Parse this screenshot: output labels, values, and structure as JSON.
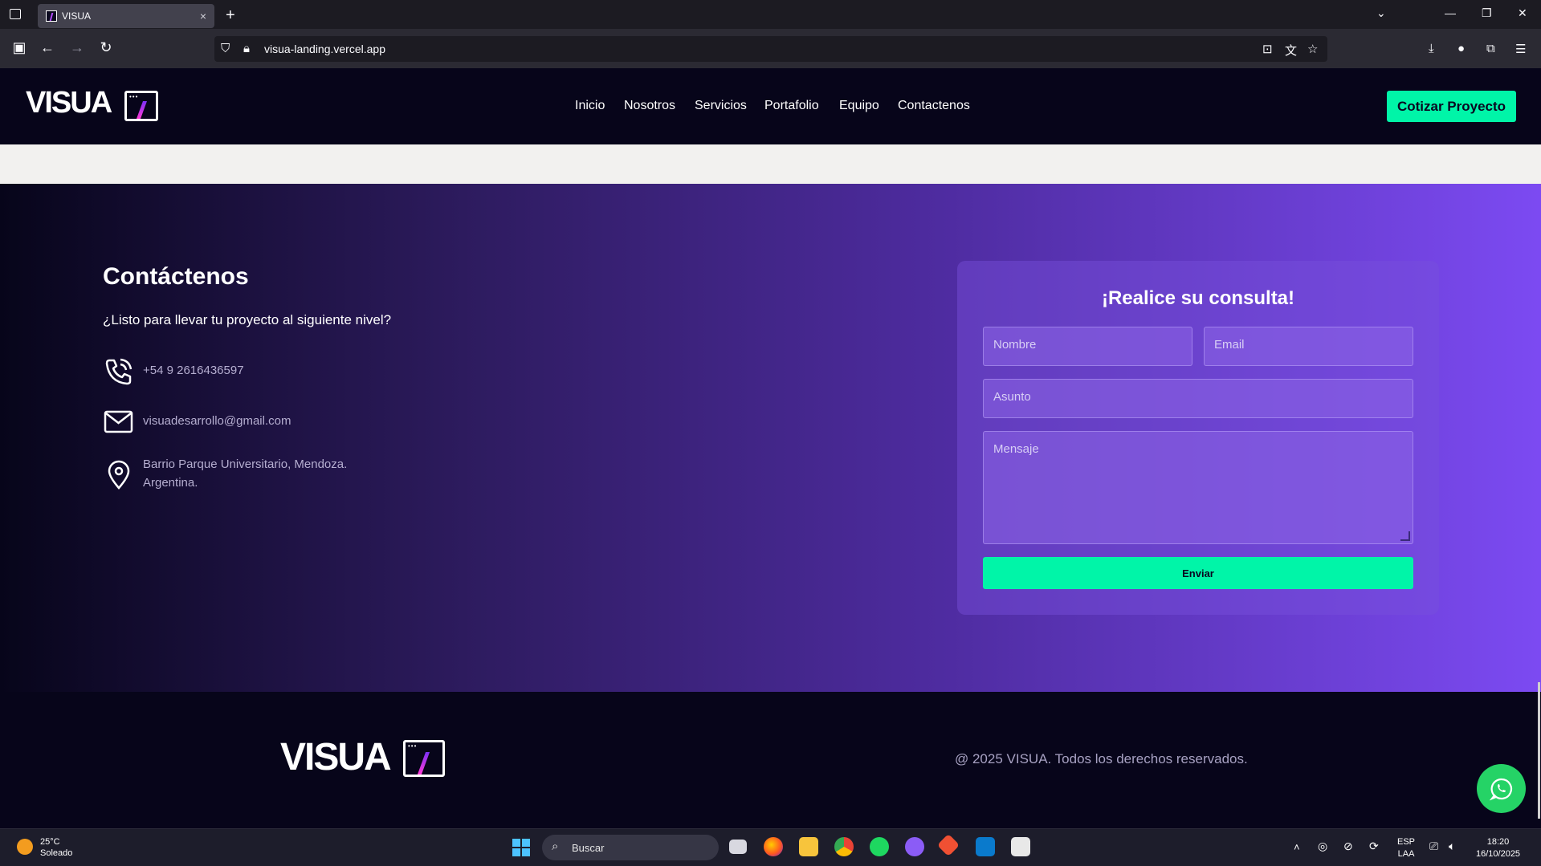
{
  "browser": {
    "tab_title": "VISUA",
    "tab_close": "×",
    "new_tab": "+",
    "url": "visua-landing.vercel.app",
    "chevron": "⌄",
    "minimize": "—",
    "restore": "❐",
    "window_close": "✕"
  },
  "header": {
    "logo": "VISUA",
    "nav": [
      "Inicio",
      "Nosotros",
      "Servicios",
      "Portafolio",
      "Equipo",
      "Contactenos"
    ],
    "cta": "Cotizar Proyecto"
  },
  "contact": {
    "title": "Contáctenos",
    "subtitle": "¿Listo para llevar tu proyecto al siguiente nivel?",
    "phone": "+54 9 2616436597",
    "email": "visuadesarrollo@gmail.com",
    "address_line1": "Barrio Parque Universitario, Mendoza.",
    "address_line2": "Argentina."
  },
  "form": {
    "title": "¡Realice su consulta!",
    "name_placeholder": "Nombre",
    "email_placeholder": "Email",
    "subject_placeholder": "Asunto",
    "message_placeholder": "Mensaje",
    "submit": "Enviar"
  },
  "footer": {
    "logo": "VISUA",
    "copyright": "@ 2025 VISUA. Todos los derechos reservados."
  },
  "taskbar": {
    "temperature": "25°C",
    "weather": "Soleado",
    "search": "Buscar",
    "lang1": "ESP",
    "lang2": "LAA",
    "time": "18:20",
    "date": "16/10/2025"
  },
  "colors": {
    "accent": "#00f5a8",
    "purple": "#7c4af2",
    "dark": "#07051a"
  }
}
